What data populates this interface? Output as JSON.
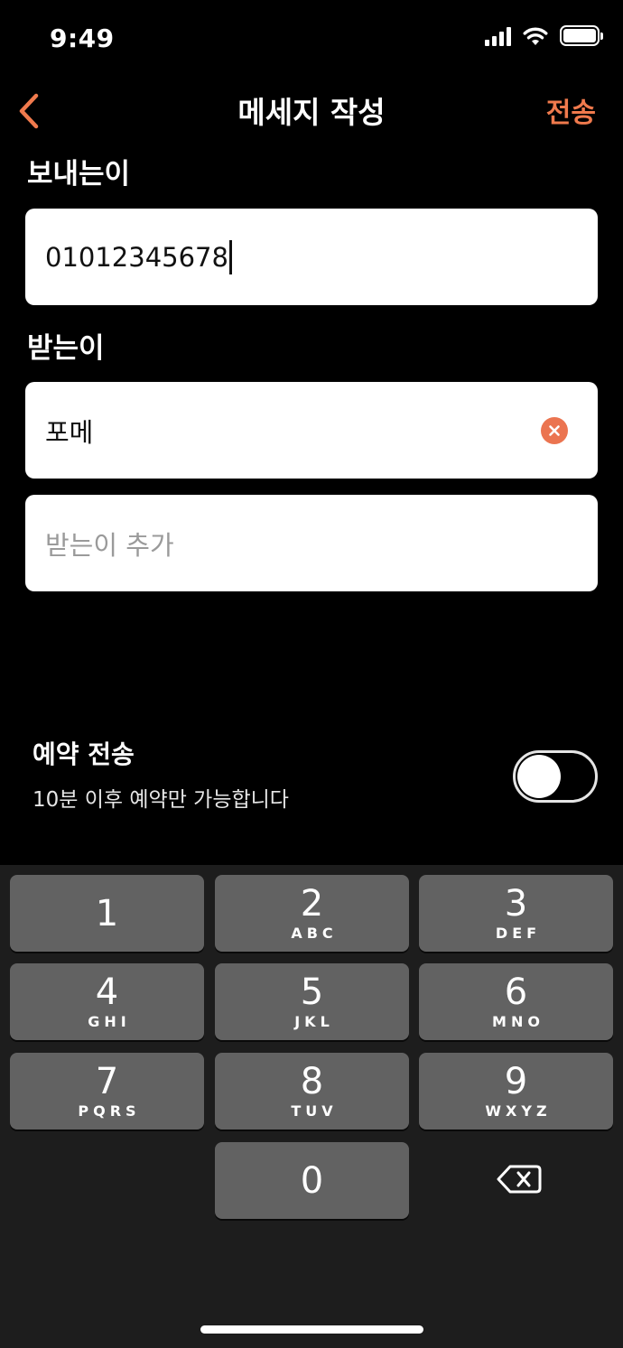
{
  "status_bar": {
    "time": "9:49"
  },
  "nav": {
    "title": "메세지 작성",
    "send_label": "전송"
  },
  "sender": {
    "label": "보내는이",
    "value": "01012345678"
  },
  "recipient": {
    "label": "받는이",
    "value": "포메",
    "add_placeholder": "받는이 추가"
  },
  "reservation": {
    "title": "예약 전송",
    "subtitle": "10분 이후 예약만 가능합니다",
    "enabled": false
  },
  "keypad": {
    "keys": [
      {
        "num": "1",
        "letters": ""
      },
      {
        "num": "2",
        "letters": "ABC"
      },
      {
        "num": "3",
        "letters": "DEF"
      },
      {
        "num": "4",
        "letters": "GHI"
      },
      {
        "num": "5",
        "letters": "JKL"
      },
      {
        "num": "6",
        "letters": "MNO"
      },
      {
        "num": "7",
        "letters": "PQRS"
      },
      {
        "num": "8",
        "letters": "TUV"
      },
      {
        "num": "9",
        "letters": "WXYZ"
      },
      {
        "num": "0",
        "letters": ""
      }
    ]
  },
  "colors": {
    "accent": "#f07a4d",
    "clear": "#eb7450",
    "key": "#626262",
    "keypad_bg": "#1d1d1d"
  }
}
